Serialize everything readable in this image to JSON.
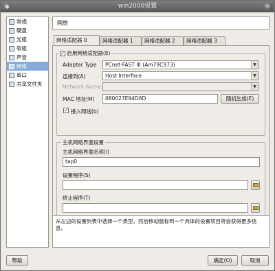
{
  "window": {
    "title": "win2000设置",
    "menu_glyph": "◆",
    "close_glyph": "✕"
  },
  "sidebar": {
    "items": [
      {
        "label": "常规",
        "icon": "general-icon"
      },
      {
        "label": "硬盘",
        "icon": "harddisk-icon"
      },
      {
        "label": "光驱",
        "icon": "cdrom-icon"
      },
      {
        "label": "软驱",
        "icon": "floppy-icon"
      },
      {
        "label": "声音",
        "icon": "audio-icon"
      },
      {
        "label": "网络",
        "icon": "network-icon",
        "selected": true
      },
      {
        "label": "串口",
        "icon": "serial-port-icon"
      },
      {
        "label": "共享文件夹",
        "icon": "shared-folder-icon"
      }
    ]
  },
  "header": {
    "title": "网络"
  },
  "tabs": [
    {
      "label": "网络适配器 0",
      "active": true
    },
    {
      "label": "网络适配器 1"
    },
    {
      "label": "网络适配器 2"
    },
    {
      "label": "网络适配器 3"
    }
  ],
  "adapter": {
    "enable_label": "启用网络适配器(E)",
    "enable_checked": true,
    "adapter_type_label": "Adapter Type",
    "adapter_type_value": "PCnet-FAST III (Am79C973)",
    "attached_to_label": "连接到(A)",
    "attached_to_value": "Host Interface",
    "network_name_label": "Network Name",
    "network_name_value": "",
    "mac_label": "MAC 地址(M)",
    "mac_value": "080027E94D6D",
    "generate_button": "随机生成(E)",
    "cable_label": "接入网线(b)",
    "cable_checked": true
  },
  "host_interface": {
    "group_title": "主机网络界面设置",
    "interface_name_label": "主机网络界面名称(I)",
    "interface_name_value": "tap0",
    "setup_app_label": "设置程序(S)",
    "setup_app_value": "",
    "terminate_app_label": "终止程序(T)",
    "terminate_app_value": ""
  },
  "info_text": "从左边的设置列表中选择一个类型，然后移动鼠标到一个具体的设置项目将会获得更多信息。",
  "buttons": {
    "help": "帮助",
    "ok": "确定(O)",
    "cancel": "取消"
  },
  "colors": {
    "selection": "#86abd9",
    "titlebar": "#575757"
  }
}
